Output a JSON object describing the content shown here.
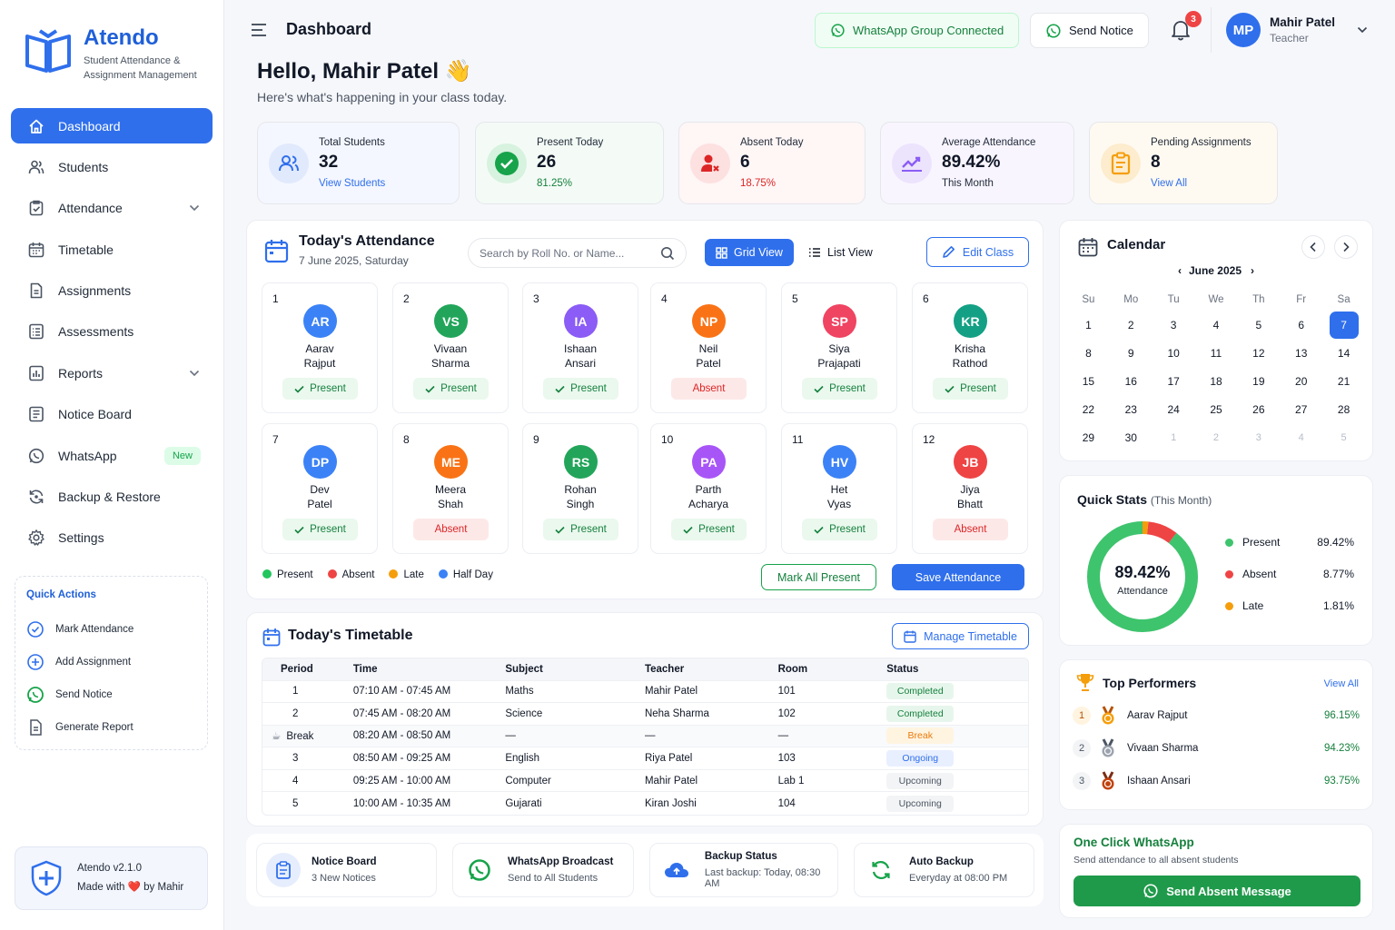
{
  "brand": {
    "name": "Atendo",
    "subtitle_line1": "Student Attendance &",
    "subtitle_line2": "Assignment Management"
  },
  "nav": [
    {
      "label": "Dashboard",
      "icon": "home-icon",
      "active": true
    },
    {
      "label": "Students",
      "icon": "users-icon"
    },
    {
      "label": "Attendance",
      "icon": "clipboard-check-icon",
      "expandable": true
    },
    {
      "label": "Timetable",
      "icon": "calendar-icon"
    },
    {
      "label": "Assignments",
      "icon": "document-icon"
    },
    {
      "label": "Assessments",
      "icon": "list-icon"
    },
    {
      "label": "Reports",
      "icon": "chart-icon",
      "expandable": true
    },
    {
      "label": "Notice Board",
      "icon": "notice-icon"
    },
    {
      "label": "WhatsApp",
      "icon": "whatsapp-icon",
      "badge": "New"
    },
    {
      "label": "Backup & Restore",
      "icon": "backup-icon"
    },
    {
      "label": "Settings",
      "icon": "gear-icon"
    }
  ],
  "quick_actions": {
    "title": "Quick Actions",
    "items": [
      "Mark Attendance",
      "Add Assignment",
      "Send Notice",
      "Generate Report"
    ]
  },
  "version": {
    "line1": "Atendo v2.1.0",
    "made_with": "Made with",
    "by": "by Mahir"
  },
  "topbar": {
    "title": "Dashboard",
    "whatsapp_status": "WhatsApp Group Connected",
    "send_notice": "Send Notice",
    "notifications": "3",
    "user_initials": "MP",
    "user_name": "Mahir Patel",
    "user_role": "Teacher"
  },
  "greeting": {
    "title": "Hello, Mahir Patel",
    "emoji": "👋",
    "subtitle": "Here's what's happening in your class today."
  },
  "stats": [
    {
      "label": "Total Students",
      "value": "32",
      "sub": "View Students"
    },
    {
      "label": "Present Today",
      "value": "26",
      "sub": "81.25%"
    },
    {
      "label": "Absent Today",
      "value": "6",
      "sub": "18.75%"
    },
    {
      "label": "Average Attendance",
      "value": "89.42%",
      "sub": "This Month"
    },
    {
      "label": "Pending Assignments",
      "value": "8",
      "sub": "View All"
    }
  ],
  "attendance": {
    "title": "Today's Attendance",
    "date": "7 June 2025, Saturday",
    "search_placeholder": "Search by Roll No. or Name...",
    "grid_view": "Grid View",
    "list_view": "List View",
    "edit_class": "Edit Class",
    "students": [
      {
        "roll": "1",
        "initials": "AR",
        "first": "Aarav",
        "last": "Rajput",
        "status": "Present",
        "color": "#3b82f6"
      },
      {
        "roll": "2",
        "initials": "VS",
        "first": "Vivaan",
        "last": "Sharma",
        "status": "Present",
        "color": "#22a55a"
      },
      {
        "roll": "3",
        "initials": "IA",
        "first": "Ishaan",
        "last": "Ansari",
        "status": "Present",
        "color": "#8b5cf6"
      },
      {
        "roll": "4",
        "initials": "NP",
        "first": "Neil",
        "last": "Patel",
        "status": "Absent",
        "color": "#f97316"
      },
      {
        "roll": "5",
        "initials": "SP",
        "first": "Siya",
        "last": "Prajapati",
        "status": "Present",
        "color": "#ef4462"
      },
      {
        "roll": "6",
        "initials": "KR",
        "first": "Krisha",
        "last": "Rathod",
        "status": "Present",
        "color": "#14a085"
      },
      {
        "roll": "7",
        "initials": "DP",
        "first": "Dev",
        "last": "Patel",
        "status": "Present",
        "color": "#3b82f6"
      },
      {
        "roll": "8",
        "initials": "ME",
        "first": "Meera",
        "last": "Shah",
        "status": "Absent",
        "color": "#f97316"
      },
      {
        "roll": "9",
        "initials": "RS",
        "first": "Rohan",
        "last": "Singh",
        "status": "Present",
        "color": "#22a55a"
      },
      {
        "roll": "10",
        "initials": "PA",
        "first": "Parth",
        "last": "Acharya",
        "status": "Present",
        "color": "#a855f7"
      },
      {
        "roll": "11",
        "initials": "HV",
        "first": "Het",
        "last": "Vyas",
        "status": "Present",
        "color": "#3b82f6"
      },
      {
        "roll": "12",
        "initials": "JB",
        "first": "Jiya",
        "last": "Bhatt",
        "status": "Absent",
        "color": "#ef4444"
      }
    ],
    "legend": [
      {
        "label": "Present",
        "color": "#22c55e"
      },
      {
        "label": "Absent",
        "color": "#ef4444"
      },
      {
        "label": "Late",
        "color": "#f59e0b"
      },
      {
        "label": "Half Day",
        "color": "#3b82f6"
      }
    ],
    "mark_all_present": "Mark All Present",
    "save": "Save Attendance"
  },
  "timetable": {
    "title": "Today's Timetable",
    "manage": "Manage Timetable",
    "headers": [
      "Period",
      "Time",
      "Subject",
      "Teacher",
      "Room",
      "Status"
    ],
    "rows": [
      {
        "period": "1",
        "time": "07:10 AM - 07:45 AM",
        "subject": "Maths",
        "teacher": "Mahir Patel",
        "room": "101",
        "status": "Completed",
        "kind": "completed"
      },
      {
        "period": "2",
        "time": "07:45 AM - 08:20 AM",
        "subject": "Science",
        "teacher": "Neha Sharma",
        "room": "102",
        "status": "Completed",
        "kind": "completed"
      },
      {
        "period": "Break",
        "time": "08:20 AM - 08:50 AM",
        "subject": "—",
        "teacher": "—",
        "room": "—",
        "status": "Break",
        "kind": "break"
      },
      {
        "period": "3",
        "time": "08:50 AM - 09:25 AM",
        "subject": "English",
        "teacher": "Riya Patel",
        "room": "103",
        "status": "Ongoing",
        "kind": "ongoing"
      },
      {
        "period": "4",
        "time": "09:25 AM - 10:00 AM",
        "subject": "Computer",
        "teacher": "Mahir Patel",
        "room": "Lab 1",
        "status": "Upcoming",
        "kind": "upcoming"
      },
      {
        "period": "5",
        "time": "10:00 AM - 10:35 AM",
        "subject": "Gujarati",
        "teacher": "Kiran Joshi",
        "room": "104",
        "status": "Upcoming",
        "kind": "upcoming"
      }
    ]
  },
  "bottom_cards": [
    {
      "title": "Notice Board",
      "sub": "3 New Notices"
    },
    {
      "title": "WhatsApp Broadcast",
      "sub": "Send to All Students"
    },
    {
      "title": "Backup Status",
      "sub": "Last backup: Today, 08:30 AM"
    },
    {
      "title": "Auto Backup",
      "sub": "Everyday at 08:00 PM"
    }
  ],
  "calendar": {
    "title": "Calendar",
    "month": "June 2025",
    "weekdays": [
      "Su",
      "Mo",
      "Tu",
      "We",
      "Th",
      "Fr",
      "Sa"
    ],
    "days": [
      "1",
      "2",
      "3",
      "4",
      "5",
      "6",
      "7",
      "8",
      "9",
      "10",
      "11",
      "12",
      "13",
      "14",
      "15",
      "16",
      "17",
      "18",
      "19",
      "20",
      "21",
      "22",
      "23",
      "24",
      "25",
      "26",
      "27",
      "28",
      "29",
      "30"
    ],
    "next_days": [
      "1",
      "2",
      "3",
      "4",
      "5"
    ],
    "selected": "7"
  },
  "quick_stats": {
    "title": "Quick Stats",
    "period": "(This Month)",
    "center_value": "89.42%",
    "center_label": "Attendance",
    "items": [
      {
        "label": "Present",
        "value": "89.42%",
        "pct": 89.42,
        "color": "#3ec46d"
      },
      {
        "label": "Absent",
        "value": "8.77%",
        "pct": 8.77,
        "color": "#ef4444"
      },
      {
        "label": "Late",
        "value": "1.81%",
        "pct": 1.81,
        "color": "#f59e0b"
      }
    ]
  },
  "top_performers": {
    "title": "Top Performers",
    "view_all": "View All",
    "items": [
      {
        "rank": "1",
        "name": "Aarav Rajput",
        "score": "96.15%",
        "medal": "gold"
      },
      {
        "rank": "2",
        "name": "Vivaan Sharma",
        "score": "94.23%",
        "medal": "silver"
      },
      {
        "rank": "3",
        "name": "Ishaan Ansari",
        "score": "93.75%",
        "medal": "bronze"
      }
    ]
  },
  "one_click": {
    "title": "One Click WhatsApp",
    "sub": "Send attendance to all absent students",
    "button": "Send Absent Message"
  }
}
